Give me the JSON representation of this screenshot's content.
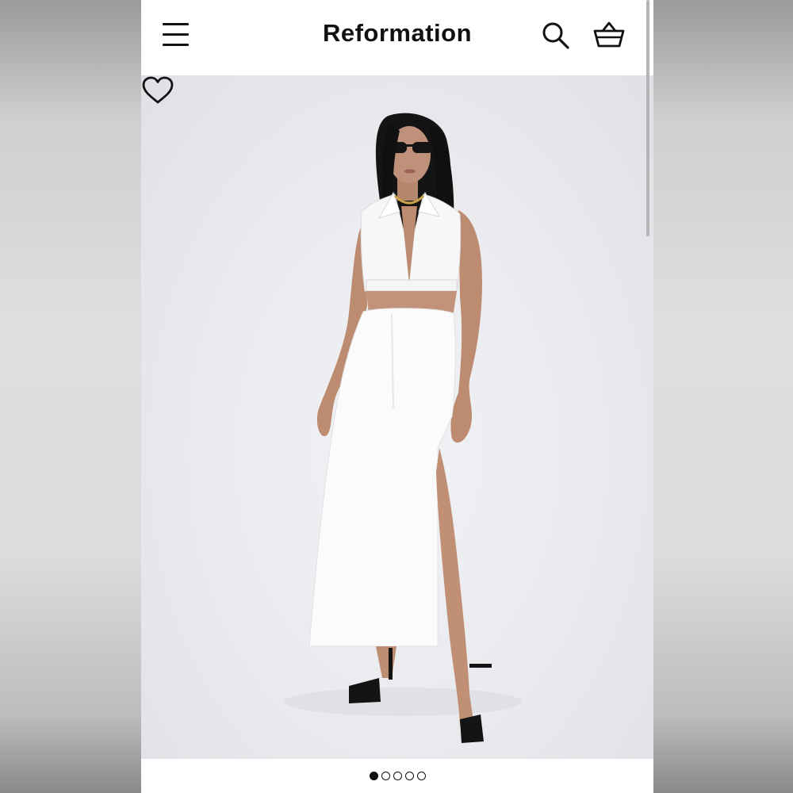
{
  "header": {
    "brand": "Reformation",
    "menu_icon": "hamburger-menu-icon",
    "search_icon": "search-icon",
    "cart_icon": "shopping-basket-icon"
  },
  "product": {
    "image_alt": "",
    "favorite_icon": "heart-icon"
  },
  "carousel": {
    "total_slides": 5,
    "active_index": 0
  },
  "colors": {
    "header_bg": "#ffffff",
    "icon": "#111111",
    "image_bg": "#e9eaee"
  }
}
